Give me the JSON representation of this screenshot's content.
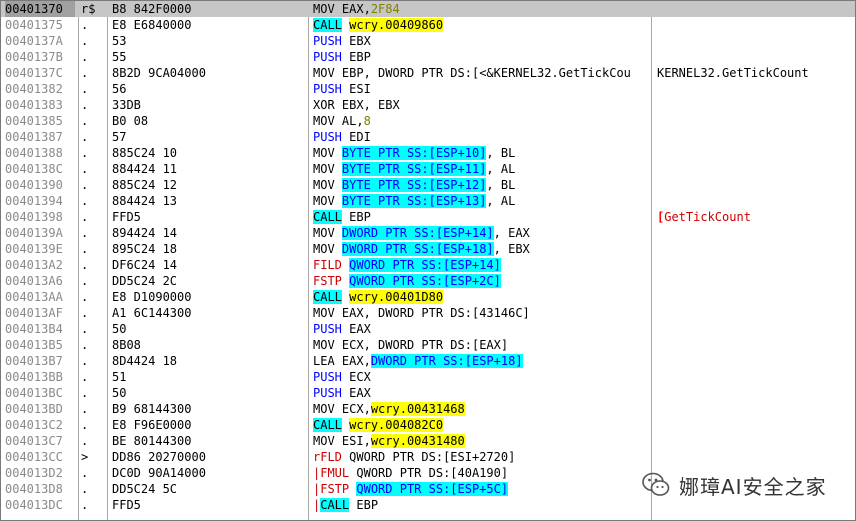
{
  "disassembly": {
    "rows": [
      {
        "addr": "00401370",
        "mark": "r$",
        "hex": "B8 842F0000",
        "mn": "MOV",
        "mn_style": "plain",
        "parts": [
          {
            "t": "EAX,",
            "s": "plain"
          },
          {
            "t": "2F84",
            "s": "num"
          }
        ],
        "cmt": "",
        "selected": true
      },
      {
        "addr": "00401375",
        "mark": ".",
        "hex": "E8 E6840000",
        "mn": "CALL",
        "mn_style": "kb",
        "parts": [
          {
            "t": "wcry.00409860",
            "s": "tgt"
          }
        ],
        "cmt": ""
      },
      {
        "addr": "0040137A",
        "mark": ".",
        "hex": "53",
        "mn": "PUSH",
        "mn_style": "k",
        "parts": [
          {
            "t": "EBX",
            "s": "plain"
          }
        ],
        "cmt": ""
      },
      {
        "addr": "0040137B",
        "mark": ".",
        "hex": "55",
        "mn": "PUSH",
        "mn_style": "k",
        "parts": [
          {
            "t": "EBP",
            "s": "plain"
          }
        ],
        "cmt": ""
      },
      {
        "addr": "0040137C",
        "mark": ".",
        "hex": "8B2D 9CA04000",
        "mn": "MOV",
        "mn_style": "plain",
        "parts": [
          {
            "t": "EBP, DWORD PTR DS:[<&KERNEL32.GetTickCou",
            "s": "plain"
          }
        ],
        "cmt": "KERNEL32.GetTickCount"
      },
      {
        "addr": "00401382",
        "mark": ".",
        "hex": "56",
        "mn": "PUSH",
        "mn_style": "k",
        "parts": [
          {
            "t": "ESI",
            "s": "plain"
          }
        ],
        "cmt": ""
      },
      {
        "addr": "00401383",
        "mark": ".",
        "hex": "33DB",
        "mn": "XOR",
        "mn_style": "plain",
        "parts": [
          {
            "t": "EBX, EBX",
            "s": "plain"
          }
        ],
        "cmt": ""
      },
      {
        "addr": "00401385",
        "mark": ".",
        "hex": "B0 08",
        "mn": "MOV",
        "mn_style": "plain",
        "parts": [
          {
            "t": "AL,",
            "s": "plain"
          },
          {
            "t": "8",
            "s": "num"
          }
        ],
        "cmt": ""
      },
      {
        "addr": "00401387",
        "mark": ".",
        "hex": "57",
        "mn": "PUSH",
        "mn_style": "k",
        "parts": [
          {
            "t": "EDI",
            "s": "plain"
          }
        ],
        "cmt": ""
      },
      {
        "addr": "00401388",
        "mark": ".",
        "hex": "885C24 10",
        "mn": "MOV",
        "mn_style": "plain",
        "parts": [
          {
            "t": "BYTE PTR SS:[ESP+10]",
            "s": "mem"
          },
          {
            "t": ", BL",
            "s": "plain"
          }
        ],
        "cmt": ""
      },
      {
        "addr": "0040138C",
        "mark": ".",
        "hex": "884424 11",
        "mn": "MOV",
        "mn_style": "plain",
        "parts": [
          {
            "t": "BYTE PTR SS:[ESP+11]",
            "s": "mem"
          },
          {
            "t": ", AL",
            "s": "plain"
          }
        ],
        "cmt": ""
      },
      {
        "addr": "00401390",
        "mark": ".",
        "hex": "885C24 12",
        "mn": "MOV",
        "mn_style": "plain",
        "parts": [
          {
            "t": "BYTE PTR SS:[ESP+12]",
            "s": "mem"
          },
          {
            "t": ", BL",
            "s": "plain"
          }
        ],
        "cmt": ""
      },
      {
        "addr": "00401394",
        "mark": ".",
        "hex": "884424 13",
        "mn": "MOV",
        "mn_style": "plain",
        "parts": [
          {
            "t": "BYTE PTR SS:[ESP+13]",
            "s": "mem"
          },
          {
            "t": ", AL",
            "s": "plain"
          }
        ],
        "cmt": ""
      },
      {
        "addr": "00401398",
        "mark": ".",
        "hex": "FFD5",
        "mn": "CALL",
        "mn_style": "kb",
        "parts": [
          {
            "t": "EBP",
            "s": "plain"
          }
        ],
        "cmt": "",
        "cmt_bracket": "[",
        "cmt_api": "GetTickCount"
      },
      {
        "addr": "0040139A",
        "mark": ".",
        "hex": "894424 14",
        "mn": "MOV",
        "mn_style": "plain",
        "parts": [
          {
            "t": "DWORD PTR SS:[ESP+14]",
            "s": "mem"
          },
          {
            "t": ", EAX",
            "s": "plain"
          }
        ],
        "cmt": ""
      },
      {
        "addr": "0040139E",
        "mark": ".",
        "hex": "895C24 18",
        "mn": "MOV",
        "mn_style": "plain",
        "parts": [
          {
            "t": "DWORD PTR SS:[ESP+18]",
            "s": "mem"
          },
          {
            "t": ", EBX",
            "s": "plain"
          }
        ],
        "cmt": ""
      },
      {
        "addr": "004013A2",
        "mark": ".",
        "hex": "DF6C24 14",
        "mn": "FILD",
        "mn_style": "kred",
        "parts": [
          {
            "t": "QWORD PTR SS:[ESP+14]",
            "s": "mem"
          }
        ],
        "cmt": ""
      },
      {
        "addr": "004013A6",
        "mark": ".",
        "hex": "DD5C24 2C",
        "mn": "FSTP",
        "mn_style": "kred",
        "parts": [
          {
            "t": "QWORD PTR SS:[ESP+2C]",
            "s": "mem"
          }
        ],
        "cmt": ""
      },
      {
        "addr": "004013AA",
        "mark": ".",
        "hex": "E8 D1090000",
        "mn": "CALL",
        "mn_style": "kb",
        "parts": [
          {
            "t": "wcry.00401D80",
            "s": "tgt"
          }
        ],
        "cmt": ""
      },
      {
        "addr": "004013AF",
        "mark": ".",
        "hex": "A1 6C144300",
        "mn": "MOV",
        "mn_style": "plain",
        "parts": [
          {
            "t": "EAX, DWORD PTR DS:[43146C]",
            "s": "plain"
          }
        ],
        "cmt": ""
      },
      {
        "addr": "004013B4",
        "mark": ".",
        "hex": "50",
        "mn": "PUSH",
        "mn_style": "k",
        "parts": [
          {
            "t": "EAX",
            "s": "plain"
          }
        ],
        "cmt": ""
      },
      {
        "addr": "004013B5",
        "mark": ".",
        "hex": "8B08",
        "mn": "MOV",
        "mn_style": "plain",
        "parts": [
          {
            "t": "ECX, DWORD PTR DS:[EAX]",
            "s": "plain"
          }
        ],
        "cmt": ""
      },
      {
        "addr": "004013B7",
        "mark": ".",
        "hex": "8D4424 18",
        "mn": "LEA",
        "mn_style": "plain",
        "parts": [
          {
            "t": "EAX,",
            "s": "plain"
          },
          {
            "t": "DWORD PTR SS:[ESP+18]",
            "s": "mem"
          }
        ],
        "cmt": ""
      },
      {
        "addr": "004013BB",
        "mark": ".",
        "hex": "51",
        "mn": "PUSH",
        "mn_style": "k",
        "parts": [
          {
            "t": "ECX",
            "s": "plain"
          }
        ],
        "cmt": ""
      },
      {
        "addr": "004013BC",
        "mark": ".",
        "hex": "50",
        "mn": "PUSH",
        "mn_style": "k",
        "parts": [
          {
            "t": "EAX",
            "s": "plain"
          }
        ],
        "cmt": ""
      },
      {
        "addr": "004013BD",
        "mark": ".",
        "hex": "B9 68144300",
        "mn": "MOV",
        "mn_style": "plain",
        "parts": [
          {
            "t": "ECX,",
            "s": "plain"
          },
          {
            "t": "wcry.00431468",
            "s": "tgt"
          }
        ],
        "cmt": ""
      },
      {
        "addr": "004013C2",
        "mark": ".",
        "hex": "E8 F96E0000",
        "mn": "CALL",
        "mn_style": "kb",
        "parts": [
          {
            "t": "wcry.004082C0",
            "s": "tgt"
          }
        ],
        "cmt": ""
      },
      {
        "addr": "004013C7",
        "mark": ".",
        "hex": "BE 80144300",
        "mn": "MOV",
        "mn_style": "plain",
        "parts": [
          {
            "t": "ESI,",
            "s": "plain"
          },
          {
            "t": "wcry.00431480",
            "s": "tgt"
          }
        ],
        "cmt": ""
      },
      {
        "addr": "004013CC",
        "mark": ">",
        "hex": "DD86 20270000",
        "mn": "FLD",
        "mn_style": "kred",
        "prefix": "r",
        "parts": [
          {
            "t": "QWORD PTR DS:[ESI+2720]",
            "s": "plain"
          }
        ],
        "cmt": ""
      },
      {
        "addr": "004013D2",
        "mark": ".",
        "hex": "DC0D 90A14000",
        "mn": "FMUL",
        "mn_style": "kred",
        "prefix": "|",
        "parts": [
          {
            "t": "QWORD PTR DS:[40A190]",
            "s": "plain"
          }
        ],
        "cmt": ""
      },
      {
        "addr": "004013D8",
        "mark": ".",
        "hex": "DD5C24 5C",
        "mn": "FSTP",
        "mn_style": "kred",
        "prefix": "|",
        "parts": [
          {
            "t": "QWORD PTR SS:[ESP+5C]",
            "s": "mem"
          }
        ],
        "cmt": ""
      },
      {
        "addr": "004013DC",
        "mark": ".",
        "hex": "FFD5",
        "mn": "CALL",
        "mn_style": "kb",
        "prefix": "|",
        "parts": [
          {
            "t": "EBP",
            "s": "plain"
          }
        ],
        "cmt": ""
      }
    ]
  },
  "watermark": {
    "text": "娜璋AI安全之家",
    "icon": "wechat-icon"
  }
}
